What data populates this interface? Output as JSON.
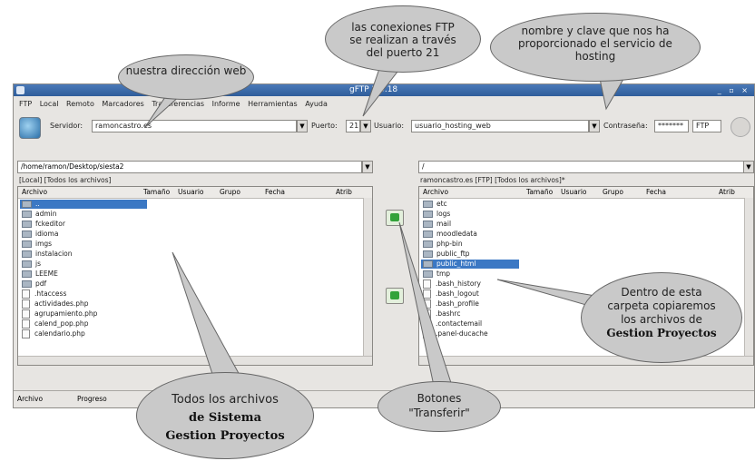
{
  "window": {
    "title": "gFTP 2.0.18"
  },
  "menu": [
    "FTP",
    "Local",
    "Remoto",
    "Marcadores",
    "Transferencias",
    "Informe",
    "Herramientas",
    "Ayuda"
  ],
  "toolbar": {
    "server_label": "Servidor:",
    "server_value": "ramoncastro.es",
    "port_label": "Puerto:",
    "port_value": "21",
    "user_label": "Usuario:",
    "user_value": "usuario_hosting_web",
    "password_label": "Contraseña:",
    "password_value": "*******",
    "protocol_value": "FTP"
  },
  "local": {
    "path": "/home/ramon/Desktop/siesta2",
    "caption": "[Local] [Todos los archivos]",
    "columns": [
      "Archivo",
      "Tamaño",
      "Usuario",
      "Grupo",
      "Fecha",
      "Atrib"
    ],
    "rows": [
      "..",
      "admin",
      "fckeditor",
      "idioma",
      "imgs",
      "instalacion",
      "js",
      "LEEME",
      "pdf",
      ".htaccess",
      "actividades.php",
      "agrupamiento.php",
      "calend_pop.php",
      "calendario.php"
    ]
  },
  "remote": {
    "path": "/",
    "caption": "ramoncastro.es [FTP] [Todos los archivos]*",
    "columns": [
      "Archivo",
      "Tamaño",
      "Usuario",
      "Grupo",
      "Fecha",
      "Atrib"
    ],
    "rows": [
      "etc",
      "logs",
      "mail",
      "moodledata",
      "php-bin",
      "public_ftp",
      "public_html",
      "tmp",
      ".bash_history",
      ".bash_logout",
      ".bash_profile",
      ".bashrc",
      ".contactemail",
      ".panel-ducache"
    ]
  },
  "statusbar": {
    "file_label": "Archivo",
    "progress_label": "Progreso"
  },
  "callouts": {
    "web": "nuestra dirección web",
    "port": "las conexiones FTP se realizan a través del puerto 21",
    "credentials": "nombre y clave que nos ha proporcionado el servicio de hosting",
    "folder_line1": "Dentro de esta carpeta copiaremos los archivos de",
    "folder_line2": "Gestion Proyectos",
    "files_line1": "Todos los archivos",
    "files_line2": "de Sistema",
    "files_line3": "Gestion Proyectos",
    "buttons": "Botones \"Transferir\""
  }
}
